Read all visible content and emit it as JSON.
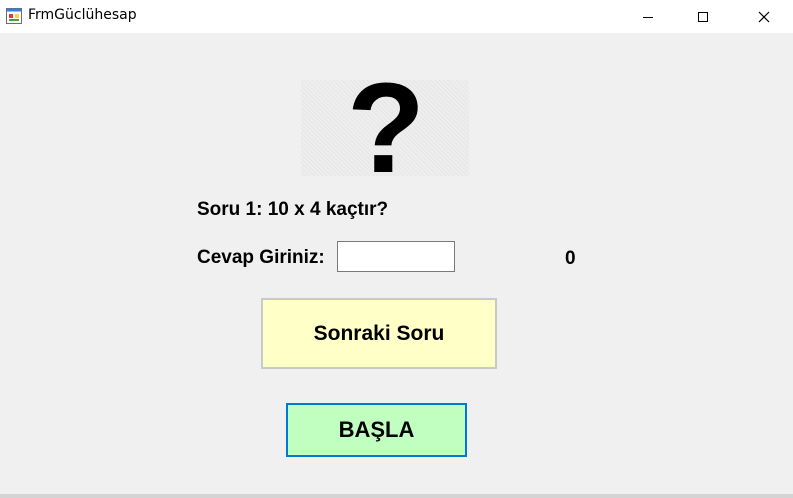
{
  "window": {
    "title": "FrmGüclühesap",
    "icon": "winforms-app-icon",
    "controls": [
      "minimize-icon",
      "maximize-icon",
      "close-icon"
    ]
  },
  "picture": {
    "icon": "question-mark-icon",
    "glyph": "?"
  },
  "quiz": {
    "question": "Soru 1: 10 x 4 kaçtır?",
    "answer_label": "Cevap Giriniz:",
    "answer_value": "",
    "score": "0"
  },
  "buttons": {
    "next_label": "Sonraki Soru",
    "start_label": "BAŞLA"
  },
  "colors": {
    "background": "#f0f0f0",
    "next_button": "#ffffc8",
    "start_button": "#c0ffc0",
    "start_button_border": "#0078d7"
  }
}
